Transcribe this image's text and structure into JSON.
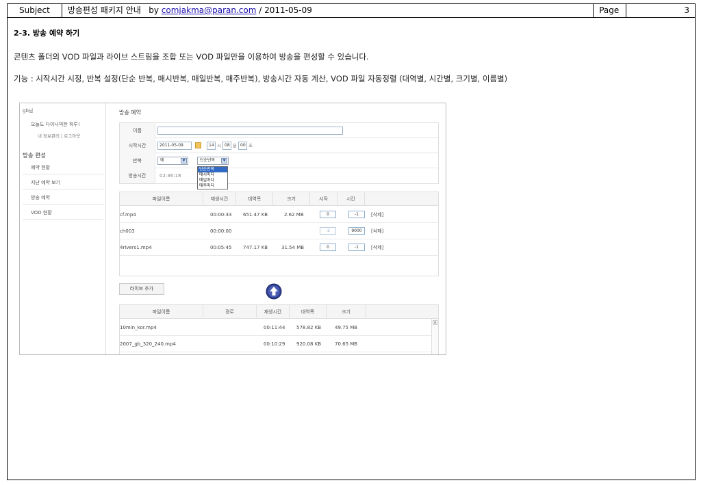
{
  "header": {
    "subject_label": "Subject",
    "title_prefix": "방송편성 패키지 안내   by ",
    "email": "comjakma@paran.com",
    "title_suffix": " / 2011-05-09",
    "page_label": "Page",
    "page_number": "3"
  },
  "section": {
    "title": "2-3. 방송 예약 하기",
    "description": "콘텐츠 폴더의 VOD 파일과 라이브 스트림을 조합 또는 VOD 파일만을 이용하여 방송을 편성할 수 있습니다.",
    "features": "기능 : 시작시간 시정, 반복 설정(단순 반복, 매시반복, 매일반복, 매주반복), 방송시간 자동 계산, VOD 파일 자동정렬 (대역별, 시간별, 크기별, 이름별)"
  },
  "screenshot": {
    "sidebar": {
      "user": "gb님",
      "greeting": "오늘도 다이나믹한 하루!",
      "links": "내 정보관리 | 로그아웃",
      "heading": "방송 편성",
      "items": [
        "예약 현황",
        "지난 예약 보기",
        "방송 예약",
        "VOD 현황"
      ]
    },
    "main_title": "방송 예약",
    "form": {
      "name_label": "이름",
      "name_value": "",
      "start_label": "시작시간",
      "start_date": "2011-05-09",
      "hour": "14",
      "hour_unit": "시",
      "minute": "08",
      "minute_unit": "분",
      "second": "00",
      "second_unit": "초",
      "repeat_label": "반복",
      "repeat_value": "예",
      "repeat_type_value": "단순반복",
      "repeat_options": [
        "단순반복",
        "매시마다",
        "매일마다",
        "매주마다"
      ],
      "duration_label": "방송시간",
      "duration_value": "02:36:18"
    },
    "schedule_table": {
      "headers": [
        "파일이름",
        "재생시간",
        "대역폭",
        "크기",
        "시작",
        "시간"
      ],
      "rows": [
        {
          "name": "cf.mp4",
          "time": "00:00:33",
          "bitrate": "651.47 KB",
          "size": "2.62 MB",
          "start": "0",
          "duration": "-1",
          "action": "[삭제]"
        },
        {
          "name": "ch003",
          "time": "00:00:00",
          "bitrate": "",
          "size": "",
          "start": "-2",
          "duration": "9000",
          "action": "[삭제]"
        },
        {
          "name": "4rivers1.mp4",
          "time": "00:05:45",
          "bitrate": "747.17 KB",
          "size": "31.54 MB",
          "start": "0",
          "duration": "-1",
          "action": "[삭제]"
        }
      ]
    },
    "live_button": "라이브 추가",
    "file_table": {
      "headers": [
        "파일이름",
        "경로",
        "재생시간",
        "대역폭",
        "크기"
      ],
      "rows": [
        {
          "name": "10min_kor.mp4",
          "path": "",
          "time": "00:11:44",
          "bitrate": "578.82 KB",
          "size": "49.75 MB"
        },
        {
          "name": "2007_gb_320_240.mp4",
          "path": "",
          "time": "00:10:29",
          "bitrate": "920.08 KB",
          "size": "70.65 MB"
        }
      ]
    }
  }
}
